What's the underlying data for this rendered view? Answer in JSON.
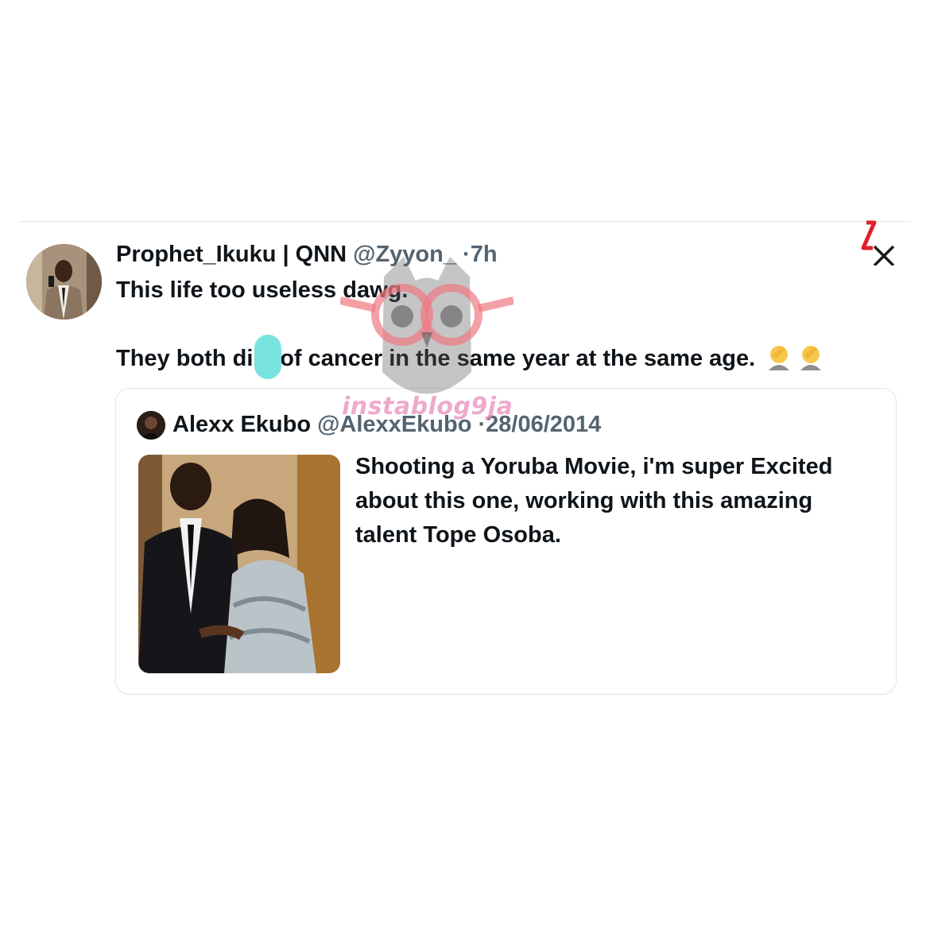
{
  "tweet": {
    "author_name": "Prophet_Ikuku | QNN",
    "handle": "@Zyyon_",
    "dot": "·",
    "time": "7h",
    "line1": "This life too useless dawg.",
    "line2": "They both di d of cancer in the same year at the same age.",
    "emoji": [
      "facepalm-emoji",
      "facepalm-emoji"
    ]
  },
  "quoted": {
    "author_name": "Alexx Ekubo",
    "handle": "@AlexxEkubo",
    "dot": "·",
    "date": "28/06/2014",
    "text_lines": [
      "Shooting a Yoruba Movie, i'm super Excited",
      "about this one, working with this amazing",
      "talent Tope Osoba."
    ]
  },
  "watermark": {
    "text": "instablog9ja",
    "color": "#e88cbe"
  },
  "brand": {
    "icon": "x-logo-icon",
    "accent": "#e0202b"
  },
  "colors": {
    "text": "#0f1419",
    "secondary": "#536471",
    "border": "#e1e6ea"
  }
}
